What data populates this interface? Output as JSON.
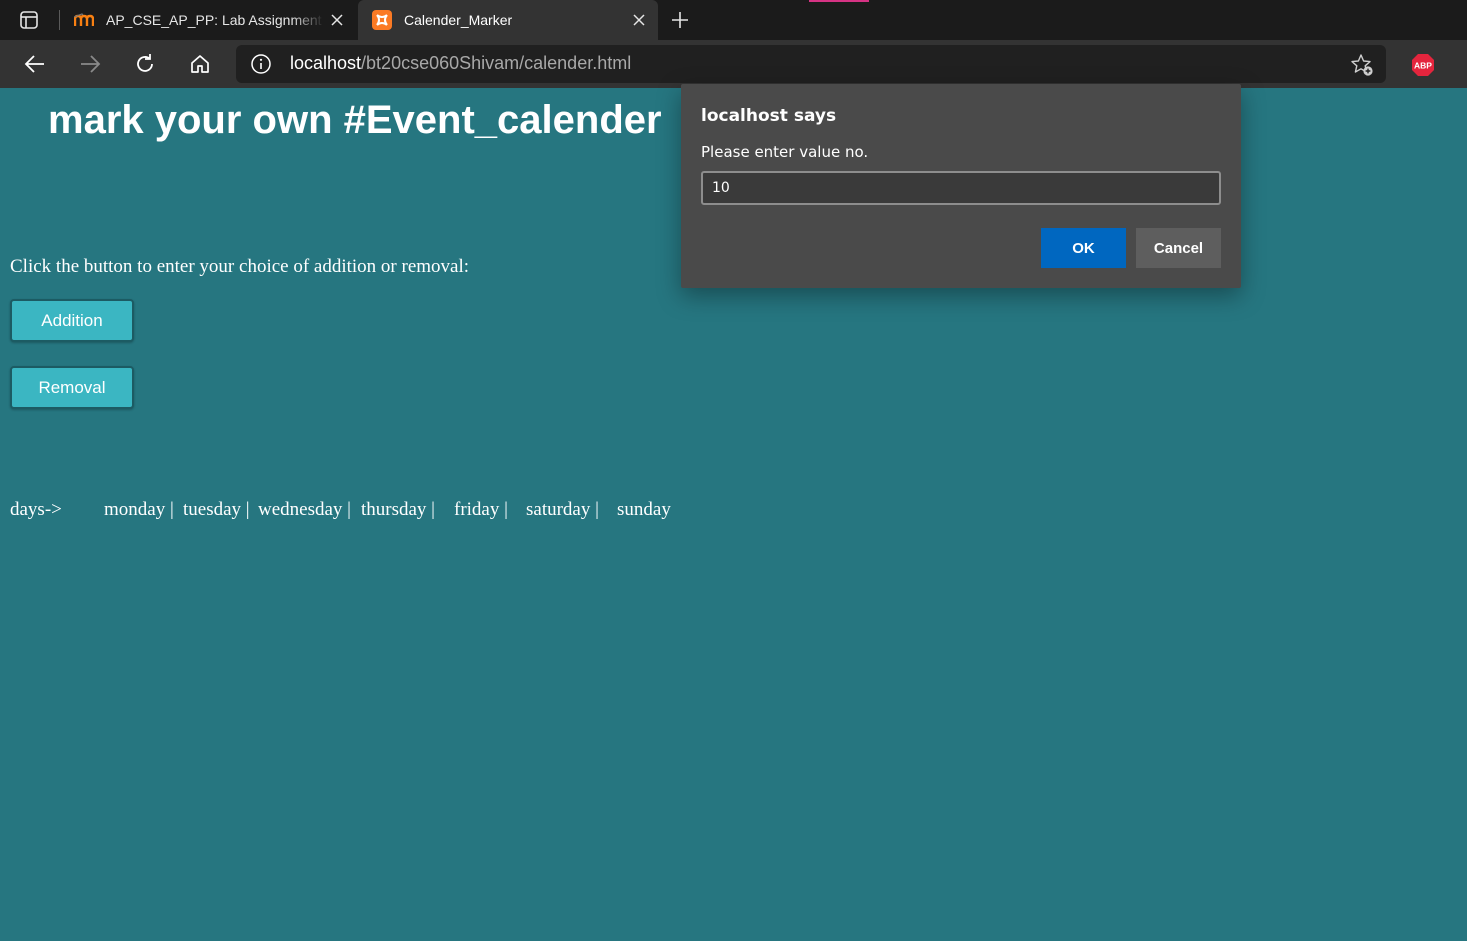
{
  "browser": {
    "tabs": [
      {
        "title": "AP_CSE_AP_PP: Lab Assignment (",
        "favicon": "moodle-icon"
      },
      {
        "title": "Calender_Marker",
        "favicon": "xampp-icon",
        "active": true
      }
    ],
    "url": {
      "host": "localhost",
      "path": "/bt20cse060Shivam/calender.html"
    },
    "extension_badge": "ABP",
    "colors": {
      "tabbar": "#1b1b1b",
      "toolbar": "#333333",
      "abp": "#e4253d"
    }
  },
  "page": {
    "background": "#267680",
    "title": "mark your own #Event_calender",
    "instruction": "Click the button to enter your choice of addition or removal:",
    "buttons": {
      "addition": "Addition",
      "removal": "Removal"
    },
    "days_label": "days->",
    "days": [
      "monday |",
      "tuesday |",
      "wednesday |",
      "thursday |",
      "friday |",
      "saturday |",
      "sunday"
    ]
  },
  "dialog": {
    "title": "localhost says",
    "message": "Please enter value no.",
    "input_value": "10",
    "ok_label": "OK",
    "cancel_label": "Cancel",
    "ok_color": "#0067c0"
  }
}
